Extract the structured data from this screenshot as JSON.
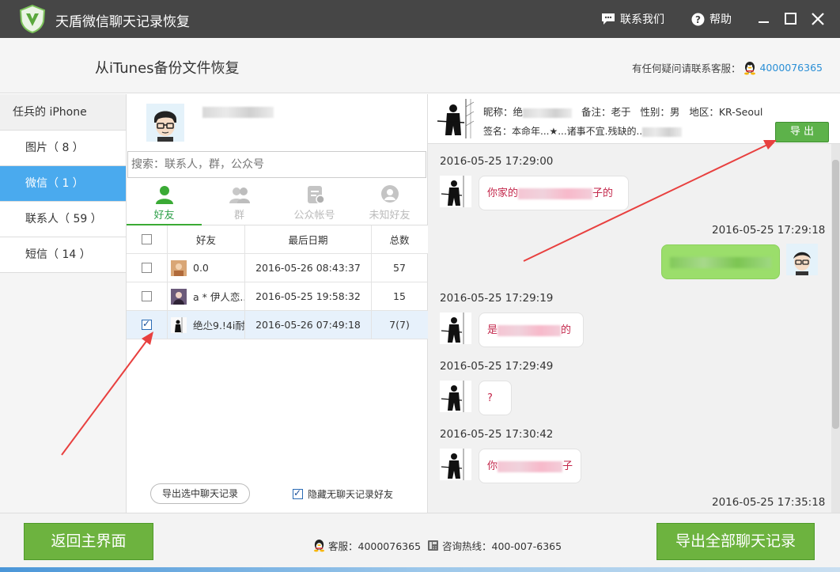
{
  "window": {
    "title": "天盾微信聊天记录恢复",
    "contact_us": "联系我们",
    "help": "帮助"
  },
  "header": {
    "title": "从iTunes备份文件恢复",
    "contact_label": "有任何疑问请联系客服：",
    "contact_qq": "4000076365"
  },
  "sidebar": {
    "device": "任兵的 iPhone",
    "items": [
      {
        "label": "图片（ 8 ）",
        "active": false
      },
      {
        "label": "微信（ 1 ）",
        "active": true
      },
      {
        "label": "联系人（ 59 ）",
        "active": false
      },
      {
        "label": "短信（ 14 ）",
        "active": false
      }
    ]
  },
  "middle": {
    "search_placeholder": "搜索：联系人，群，公众号",
    "tabs": [
      {
        "label": "好友",
        "icon": "person-icon",
        "active": true
      },
      {
        "label": "群",
        "icon": "group-icon",
        "active": false
      },
      {
        "label": "公众帐号",
        "icon": "official-account-icon",
        "active": false
      },
      {
        "label": "未知好友",
        "icon": "unknown-friend-icon",
        "active": false
      }
    ],
    "columns": [
      "好友",
      "最后日期",
      "总数"
    ],
    "rows": [
      {
        "name": "0.0",
        "date": "2016-05-26 08:43:37",
        "count": "57",
        "checked": false,
        "selected": false
      },
      {
        "name": "a * 伊人恋...",
        "date": "2016-05-25 19:58:32",
        "count": "15",
        "checked": false,
        "selected": false
      },
      {
        "name": "绝尐9.!4i耐..",
        "date": "2016-05-26 07:49:18",
        "count": "7(7)",
        "checked": true,
        "selected": true
      }
    ],
    "export_selected": "导出选中聊天记录",
    "hide_no_chat": "隐藏无聊天记录好友"
  },
  "chat": {
    "info_nickname_label": "昵称：绝",
    "info_remark": "备注：老于",
    "info_gender": "性别：男",
    "info_region": "地区：KR-Seoul",
    "info_signature_a": "签名：本命年...★...诸事不宜.残缺的..",
    "info_signature_b": "",
    "export": "导 出",
    "messages": [
      {
        "time": "2016-05-25 17:29:00",
        "side": "left",
        "prefix": "你家的",
        "suffix": "子的"
      },
      {
        "time": "2016-05-25 17:29:18",
        "side": "right",
        "prefix": "",
        "suffix": ""
      },
      {
        "time": "2016-05-25 17:29:19",
        "side": "left",
        "prefix": "是",
        "suffix": "的"
      },
      {
        "time": "2016-05-25 17:29:49",
        "side": "left",
        "prefix": "?",
        "suffix": ""
      },
      {
        "time": "2016-05-25 17:30:42",
        "side": "left",
        "prefix": "你",
        "suffix": "子"
      },
      {
        "time": "2016-05-25 17:35:18",
        "side": "right",
        "prefix": "",
        "suffix": ""
      }
    ]
  },
  "footer": {
    "back": "返回主界面",
    "service": "客服：4000076365",
    "hotline": "咨询热线：400-007-6365",
    "export_all": "导出全部聊天记录"
  },
  "colors": {
    "active_blue": "#4aaaee",
    "green": "#6db33f",
    "titlebar": "#464646",
    "highlight_arrow": "#e8403f"
  }
}
